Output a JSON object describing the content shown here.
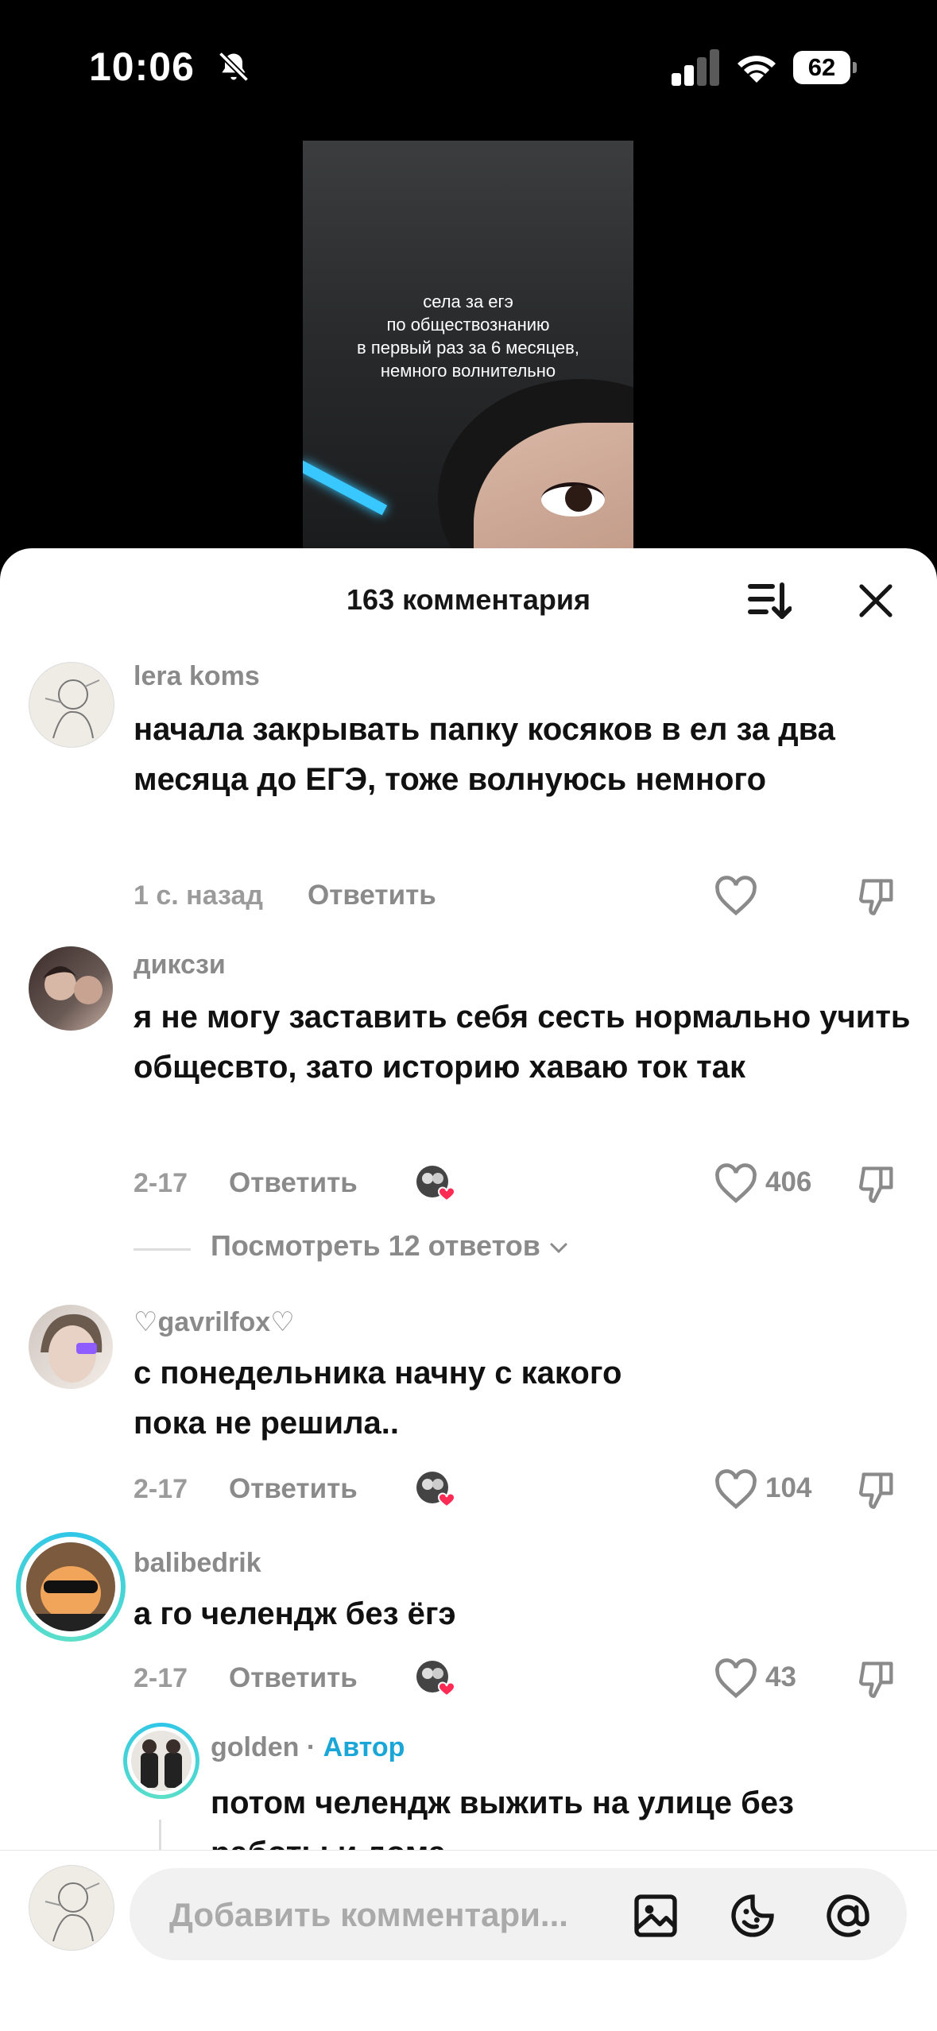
{
  "status": {
    "time": "10:06",
    "battery": "62",
    "icons": [
      "bell-off-icon",
      "signal-icon",
      "wifi-icon",
      "battery-icon"
    ]
  },
  "video": {
    "caption_lines": [
      "села за егэ",
      "по обществознанию",
      "в первый раз за 6 месяцев,",
      "немного волнительно"
    ]
  },
  "sheet": {
    "title": "163 комментария",
    "icons": [
      "sort-icon",
      "close-icon"
    ]
  },
  "comments": [
    {
      "username": "lera koms",
      "text": "начала закрывать папку косяков в ел за два месяца до ЕГЭ, тоже волнуюсь немного",
      "date": "1 с. назад",
      "reply": "Ответить",
      "likes": ""
    },
    {
      "username": "диксзи",
      "text": "я не могу заставить себя сесть нормально учить общесвто, зато историю хаваю ток так",
      "date": "2-17",
      "reply": "Ответить",
      "likes": "406",
      "view_replies": "Посмотреть 12 ответов"
    },
    {
      "username": "♡gavrilfox♡",
      "text": "с понедельника начну с какого пока не решила..",
      "date": "2-17",
      "reply": "Ответить",
      "likes": "104"
    },
    {
      "username": "balibedrik",
      "text": "а го челендж без ёгэ",
      "date": "2-17",
      "reply": "Ответить",
      "likes": "43"
    }
  ],
  "reply": {
    "username": "golden",
    "separator": " · ",
    "badge": "Автор",
    "text": "потом челендж выжить на улице без работы и дома"
  },
  "compose": {
    "placeholder": "Добавить комментари...",
    "icons": [
      "image-icon",
      "emoji-icon",
      "mention-icon"
    ]
  },
  "colors": {
    "author_badge": "#1aa7d8",
    "heart_badge": "#fe2c55",
    "story_ring": "#2fc6e8"
  }
}
